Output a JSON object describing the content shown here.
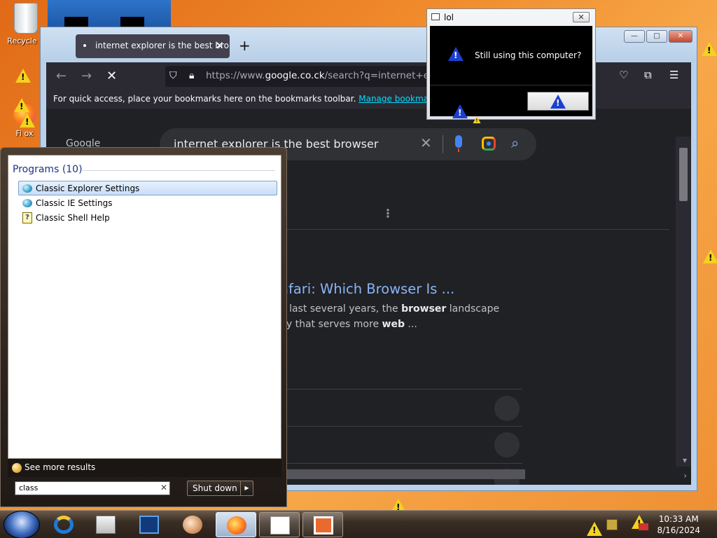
{
  "desktop": {
    "recycle_bin_label": "Recycle B",
    "firefox_label": "Fi    ox"
  },
  "browser": {
    "tab_title": "internet explorer is the best bro",
    "url_prefix": "https://www.",
    "url_domain": "google.co.ck",
    "url_rest": "/search?q=internet+explor",
    "bookmarks_hint": "For quick access, place your bookmarks here on the bookmarks toolbar.",
    "bookmarks_link": "Manage bookmarks...",
    "google_label": "Google",
    "search_query": "internet explorer is the best browser",
    "result_title": "afari: Which Browser Is ...",
    "snippet_line1_pre": "e last several years, the ",
    "snippet_line1_bold": "browser",
    "snippet_line1_post": " landscape",
    "snippet_line2_pre": "ny that serves more ",
    "snippet_line2_bold": "web",
    "snippet_line2_post": " ..."
  },
  "dialog": {
    "title": "lol",
    "message": "Still using this computer?"
  },
  "start_menu": {
    "section_heading": "Programs (10)",
    "items": [
      {
        "label": "Classic Explorer Settings"
      },
      {
        "label": "Classic IE Settings"
      },
      {
        "label": "Classic Shell Help"
      }
    ],
    "see_more": "See more results",
    "search_value": "class",
    "shutdown_label": "Shut down"
  },
  "taskbar": {
    "time": "10:33 AM",
    "date": "8/16/2024"
  },
  "colors": {
    "accent_link": "#00ddff",
    "google_link": "#8ab4f8",
    "warning_yellow": "#f4d21f",
    "warning_blue": "#1c3fd0"
  }
}
